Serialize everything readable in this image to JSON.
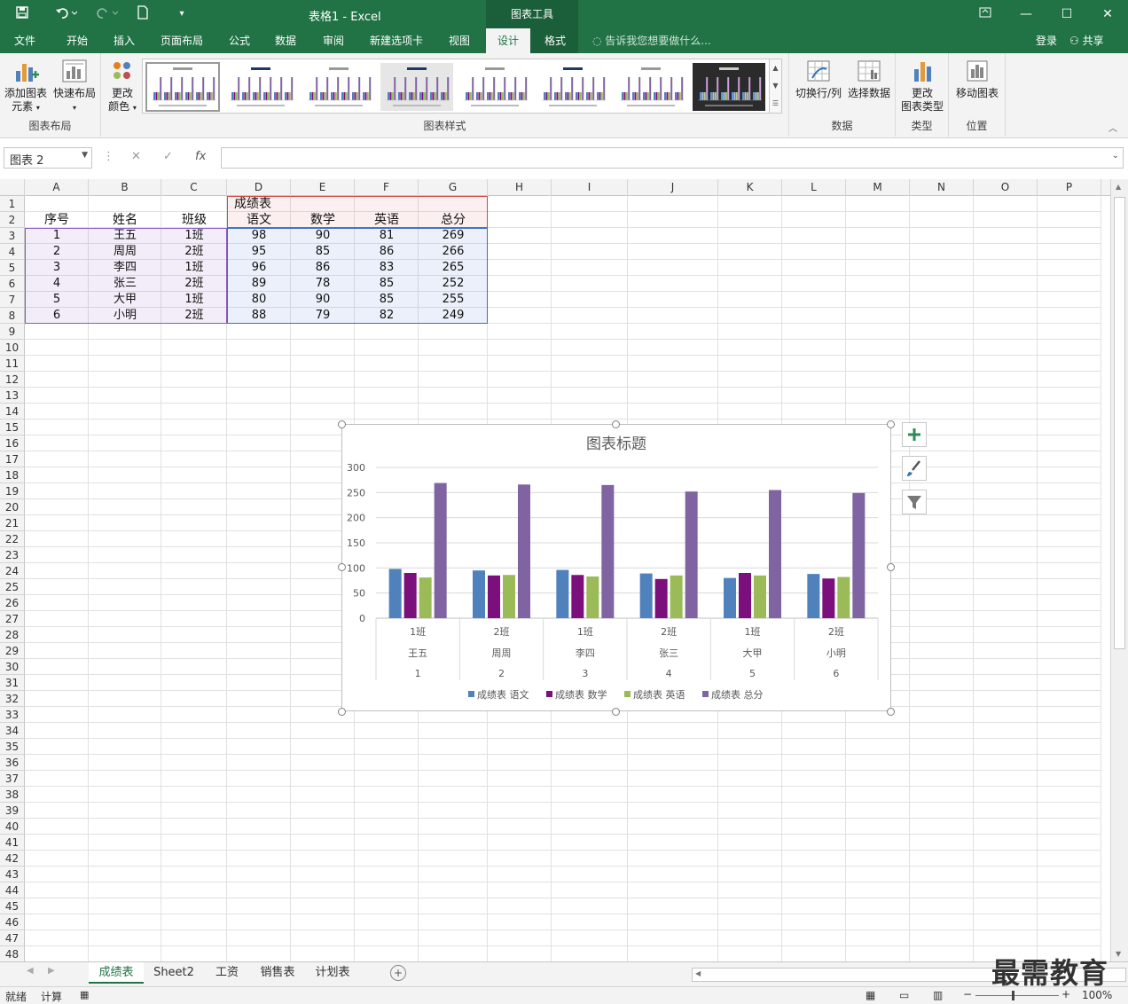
{
  "titlebar": {
    "title": "表格1 - Excel",
    "context_tools": "图表工具",
    "save_icon": "save-icon",
    "undo_icon": "undo-icon",
    "redo_icon": "redo-icon",
    "new_icon": "new-file-icon"
  },
  "tabs": {
    "file": "文件",
    "items": [
      "开始",
      "插入",
      "页面布局",
      "公式",
      "数据",
      "审阅",
      "新建选项卡",
      "视图",
      "设计",
      "格式"
    ],
    "active": "设计",
    "tell_me": "告诉我您想要做什么...",
    "login": "登录",
    "share": "共享"
  },
  "ribbon": {
    "add_element": "添加图表元素",
    "add_element_l1": "添加图表",
    "add_element_l2": "元素",
    "quick_layout": "快速布局",
    "group_layout": "图表布局",
    "change_color_l1": "更改",
    "change_color_l2": "颜色",
    "group_styles": "图表样式",
    "switch_rowcol": "切换行/列",
    "select_data": "选择数据",
    "group_data": "数据",
    "change_type_l1": "更改",
    "change_type_l2": "图表类型",
    "group_type": "类型",
    "move_chart": "移动图表",
    "group_location": "位置"
  },
  "formula_bar": {
    "name_box": "图表 2",
    "formula": ""
  },
  "columns": [
    "A",
    "B",
    "C",
    "D",
    "E",
    "F",
    "G",
    "H",
    "I",
    "J",
    "K",
    "L",
    "M",
    "N",
    "O",
    "P"
  ],
  "rows": [
    "1",
    "2",
    "3",
    "4",
    "5",
    "6",
    "7",
    "8",
    "9",
    "10",
    "11",
    "12",
    "13",
    "14",
    "15",
    "16",
    "17",
    "18",
    "19",
    "20",
    "21",
    "22",
    "23",
    "24",
    "25",
    "26",
    "27",
    "28",
    "29",
    "30",
    "31",
    "32",
    "33",
    "34",
    "35",
    "36",
    "37",
    "38",
    "39",
    "40",
    "41",
    "42",
    "43",
    "44",
    "45",
    "46",
    "47",
    "48"
  ],
  "sheet": {
    "group_header": "成绩表",
    "headers": [
      "序号",
      "姓名",
      "班级",
      "语文",
      "数学",
      "英语",
      "总分"
    ],
    "data": [
      [
        "1",
        "王五",
        "1班",
        "98",
        "90",
        "81",
        "269"
      ],
      [
        "2",
        "周周",
        "2班",
        "95",
        "85",
        "86",
        "266"
      ],
      [
        "3",
        "李四",
        "1班",
        "96",
        "86",
        "83",
        "265"
      ],
      [
        "4",
        "张三",
        "2班",
        "89",
        "78",
        "85",
        "252"
      ],
      [
        "5",
        "大甲",
        "1班",
        "80",
        "90",
        "85",
        "255"
      ],
      [
        "6",
        "小明",
        "2班",
        "88",
        "79",
        "82",
        "249"
      ]
    ]
  },
  "chart_data": {
    "type": "bar",
    "title": "图表标题",
    "categories_levels": [
      [
        "1班",
        "2班",
        "1班",
        "2班",
        "1班",
        "2班"
      ],
      [
        "王五",
        "周周",
        "李四",
        "张三",
        "大甲",
        "小明"
      ],
      [
        "1",
        "2",
        "3",
        "4",
        "5",
        "6"
      ]
    ],
    "series": [
      {
        "name": "成绩表 语文",
        "color": "#4f81bd",
        "values": [
          98,
          95,
          96,
          89,
          80,
          88
        ]
      },
      {
        "name": "成绩表 数学",
        "color": "#7b0f7b",
        "values": [
          90,
          85,
          86,
          78,
          90,
          79
        ]
      },
      {
        "name": "成绩表 英语",
        "color": "#9bbb59",
        "values": [
          81,
          86,
          83,
          85,
          85,
          82
        ]
      },
      {
        "name": "成绩表 总分",
        "color": "#8064a2",
        "values": [
          269,
          266,
          265,
          252,
          255,
          249
        ]
      }
    ],
    "yticks": [
      "0",
      "50",
      "100",
      "150",
      "200",
      "250",
      "300"
    ],
    "ylim": [
      0,
      300
    ],
    "grid": true,
    "legend": "bottom"
  },
  "sheet_tabs": [
    "成绩表",
    "Sheet2",
    "工资",
    "销售表",
    "计划表"
  ],
  "active_sheet": "成绩表",
  "status": {
    "ready": "就绪",
    "calc": "计算",
    "zoom": "100%"
  },
  "watermark": "最需教育"
}
